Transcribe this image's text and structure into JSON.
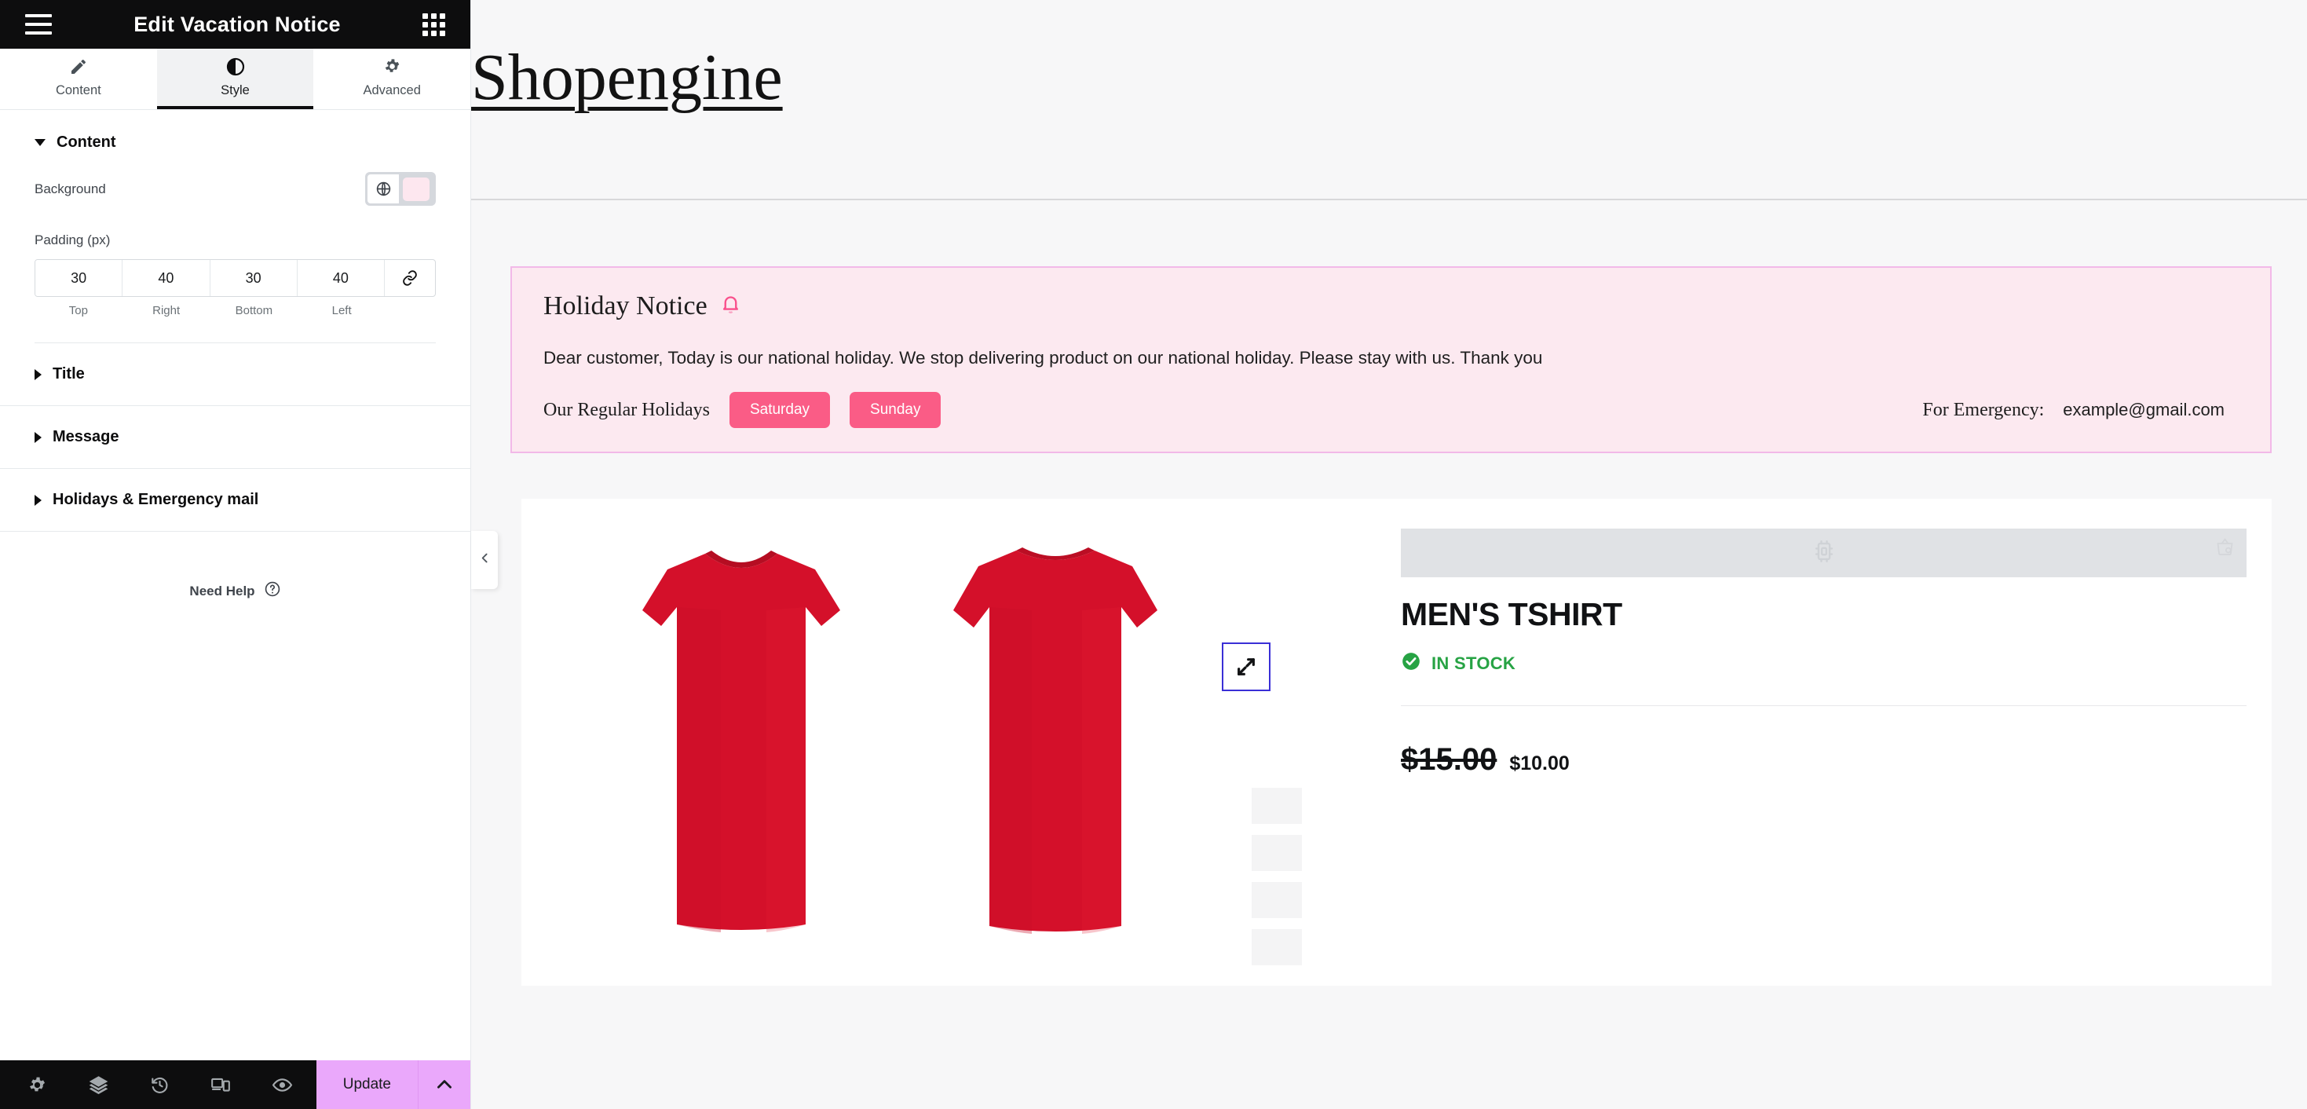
{
  "panel": {
    "header": {
      "title": "Edit Vacation Notice",
      "menu_icon": "hamburger-icon",
      "widgets_icon": "grid-icon"
    },
    "tabs": [
      {
        "label": "Content",
        "icon": "pencil-icon",
        "active": false
      },
      {
        "label": "Style",
        "icon": "contrast-icon",
        "active": true
      },
      {
        "label": "Advanced",
        "icon": "gear-icon",
        "active": false
      }
    ],
    "content_section": {
      "title": "Content",
      "background": {
        "label": "Background",
        "globe_icon": "globe-icon",
        "color": "#fde7ef"
      },
      "padding": {
        "label": "Padding (px)",
        "values": [
          "30",
          "40",
          "30",
          "40"
        ],
        "labels": [
          "Top",
          "Right",
          "Bottom",
          "Left"
        ],
        "link_icon": "link-icon"
      }
    },
    "collapsed_sections": [
      {
        "label": "Title"
      },
      {
        "label": "Message"
      },
      {
        "label": "Holidays & Emergency mail"
      }
    ],
    "need_help": {
      "label": "Need Help",
      "icon": "question-circle-icon"
    },
    "footer": {
      "tools": [
        {
          "name": "settings",
          "icon": "gear-icon"
        },
        {
          "name": "navigator",
          "icon": "layers-icon"
        },
        {
          "name": "history",
          "icon": "history-icon"
        },
        {
          "name": "responsive",
          "icon": "devices-icon"
        },
        {
          "name": "preview",
          "icon": "eye-icon"
        }
      ],
      "update_label": "Update",
      "update_arrow_icon": "chevron-up-icon",
      "update_color": "#eaa8fb"
    },
    "collapse_tab_icon": "chevron-left-icon"
  },
  "canvas": {
    "logo": "Shopengine",
    "notice": {
      "title": "Holiday Notice",
      "bell_icon": "bell-icon",
      "bell_color": "#f9508c",
      "message": "Dear customer, Today is our national holiday. We stop delivering product on our national holiday. Please stay with us. Thank you",
      "holidays_label": "Our Regular Holidays",
      "days": [
        "Saturday",
        "Sunday"
      ],
      "day_chip_color": "#fa5c86",
      "emergency_label": "For Emergency:",
      "emergency_email": "example@gmail.com",
      "background": "#fce9f0",
      "border": "#f2b9e8"
    },
    "product": {
      "placeholder_icon": "chip-widget-icon",
      "placeholder_corner_icon": "shop-icon",
      "title": "MEN'S TSHIRT",
      "stock_status": "IN STOCK",
      "stock_icon": "check-circle-icon",
      "stock_color": "#27a344",
      "price_old": "$15.00",
      "price_new": "$10.00",
      "expand_icon": "expand-arrows-icon",
      "gallery_images": [
        "red-tshirt-front",
        "red-tshirt-back"
      ]
    }
  }
}
